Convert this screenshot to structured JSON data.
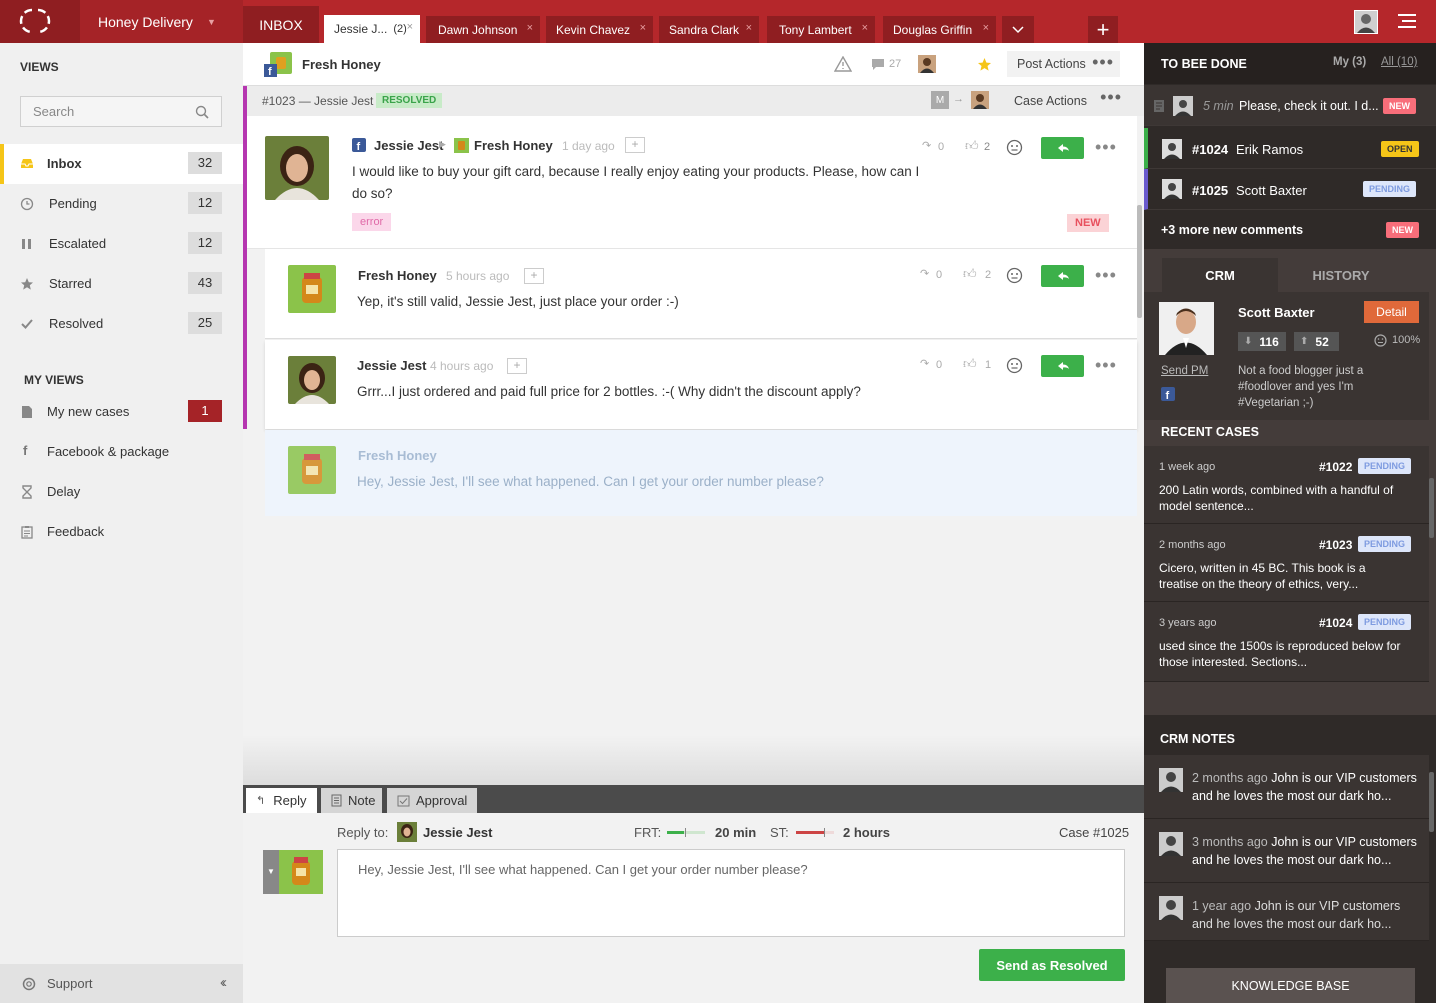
{
  "app": {
    "brand": "Honey Delivery"
  },
  "tabs": {
    "inbox": "INBOX",
    "items": [
      {
        "label": "Jessie J...",
        "count": "(2)"
      },
      {
        "label": "Dawn Johnson"
      },
      {
        "label": "Kevin Chavez"
      },
      {
        "label": "Sandra Clark"
      },
      {
        "label": "Tony Lambert"
      },
      {
        "label": "Douglas Griffin"
      }
    ],
    "close": "×",
    "add": "+"
  },
  "sidebar": {
    "views_title": "VIEWS",
    "search_placeholder": "Search",
    "views": [
      {
        "label": "Inbox",
        "count": "32"
      },
      {
        "label": "Pending",
        "count": "12"
      },
      {
        "label": "Escalated",
        "count": "12"
      },
      {
        "label": "Starred",
        "count": "43"
      },
      {
        "label": "Resolved",
        "count": "25"
      }
    ],
    "my_views_title": "MY VIEWS",
    "my_views": [
      {
        "label": "My new cases",
        "count": "1"
      },
      {
        "label": "Facebook & package"
      },
      {
        "label": "Delay"
      },
      {
        "label": "Feedback"
      }
    ],
    "support": "Support"
  },
  "conversation": {
    "page_name": "Fresh Honey",
    "comment_count": "27",
    "post_actions": "Post Actions",
    "case_ref": "#1023 — Jessie Jest",
    "case_status": "RESOLVED",
    "case_actions": "Case Actions",
    "assignee_initial": "M",
    "main_post": {
      "author": "Jessie Jest",
      "target": "Fresh Honey",
      "ago": "1 day ago",
      "text": "I would like to buy your gift card, because I really enjoy eating your products. Please, how can I do so?",
      "tag": "error",
      "badge": "NEW",
      "shares": "0",
      "likes": "2"
    },
    "replies": [
      {
        "author": "Fresh Honey",
        "ago": "5 hours ago",
        "text": "Yep, it's still valid, Jessie Jest, just place your order :-)",
        "shares": "0",
        "likes": "2"
      },
      {
        "author": "Jessie Jest",
        "ago": "4 hours ago",
        "text": "Grrr...I just ordered and paid full price for 2 bottles. :-( Why didn't the discount apply?",
        "shares": "0",
        "likes": "1"
      }
    ],
    "draft": {
      "author": "Fresh Honey",
      "text": "Hey, Jessie Jest, I'll see what happened. Can I get your order number please?"
    }
  },
  "reply_box": {
    "tabs": [
      "Reply",
      "Note",
      "Approval"
    ],
    "reply_to_label": "Reply to:",
    "reply_to_name": "Jessie Jest",
    "frt_label": "FRT:",
    "frt_value": "20 min",
    "frt_level": 0.45,
    "st_label": "ST:",
    "st_value": "2 hours",
    "st_level": 0.75,
    "case_label": "Case #1025",
    "text": "Hey, Jessie Jest, I'll see what happened. Can I get your order number please?",
    "send_label": "Send as Resolved"
  },
  "right": {
    "todo_title": "TO BEE DONE",
    "my_filter": "My (3)",
    "all_filter": "All (10)",
    "todo_items": [
      {
        "time": "5 min",
        "text": "Please, check it out. I d...",
        "badge": "NEW"
      },
      {
        "id": "#1024",
        "name": "Erik Ramos",
        "badge": "OPEN"
      },
      {
        "id": "#1025",
        "name": "Scott Baxter",
        "badge": "PENDING"
      }
    ],
    "more_comments": "+3 more new comments",
    "more_badge": "NEW",
    "crm_tabs": [
      "CRM",
      "HISTORY"
    ],
    "profile": {
      "name": "Scott Baxter",
      "detail": "Detail",
      "down": "116",
      "up": "52",
      "score": "100%",
      "send_pm": "Send PM",
      "bio": "Not a food blogger just a #foodlover and yes I'm #Vegetarian ;-)"
    },
    "recent_title": "RECENT CASES",
    "recent_cases": [
      {
        "ago": "1 week ago",
        "id": "#1022",
        "status": "PENDING",
        "text": "200 Latin words, combined with a handful of model sentence..."
      },
      {
        "ago": "2 months ago",
        "id": "#1023",
        "status": "PENDING",
        "text": "Cicero, written in 45 BC. This book is a treatise on the theory of ethics, very..."
      },
      {
        "ago": "3 years ago",
        "id": "#1024",
        "status": "PENDING",
        "text": "used since the 1500s is reproduced below for those interested. Sections..."
      }
    ],
    "notes_title": "CRM NOTES",
    "notes": [
      {
        "ago": "2 months ago",
        "text": "John is our VIP customers and he  loves the most our dark ho..."
      },
      {
        "ago": "3 months ago",
        "text": "John is our VIP customers and he  loves the most our dark ho..."
      },
      {
        "ago": "1 year ago",
        "text": "John is our VIP customers and he  loves the most our dark ho..."
      }
    ],
    "kb_button": "KNOWLEDGE BASE"
  },
  "colors": {
    "brand": "#b5272b",
    "accent": "#3cb04a",
    "new": "#f86e7a",
    "open": "#f5c518",
    "pending": "#7e9be0"
  }
}
